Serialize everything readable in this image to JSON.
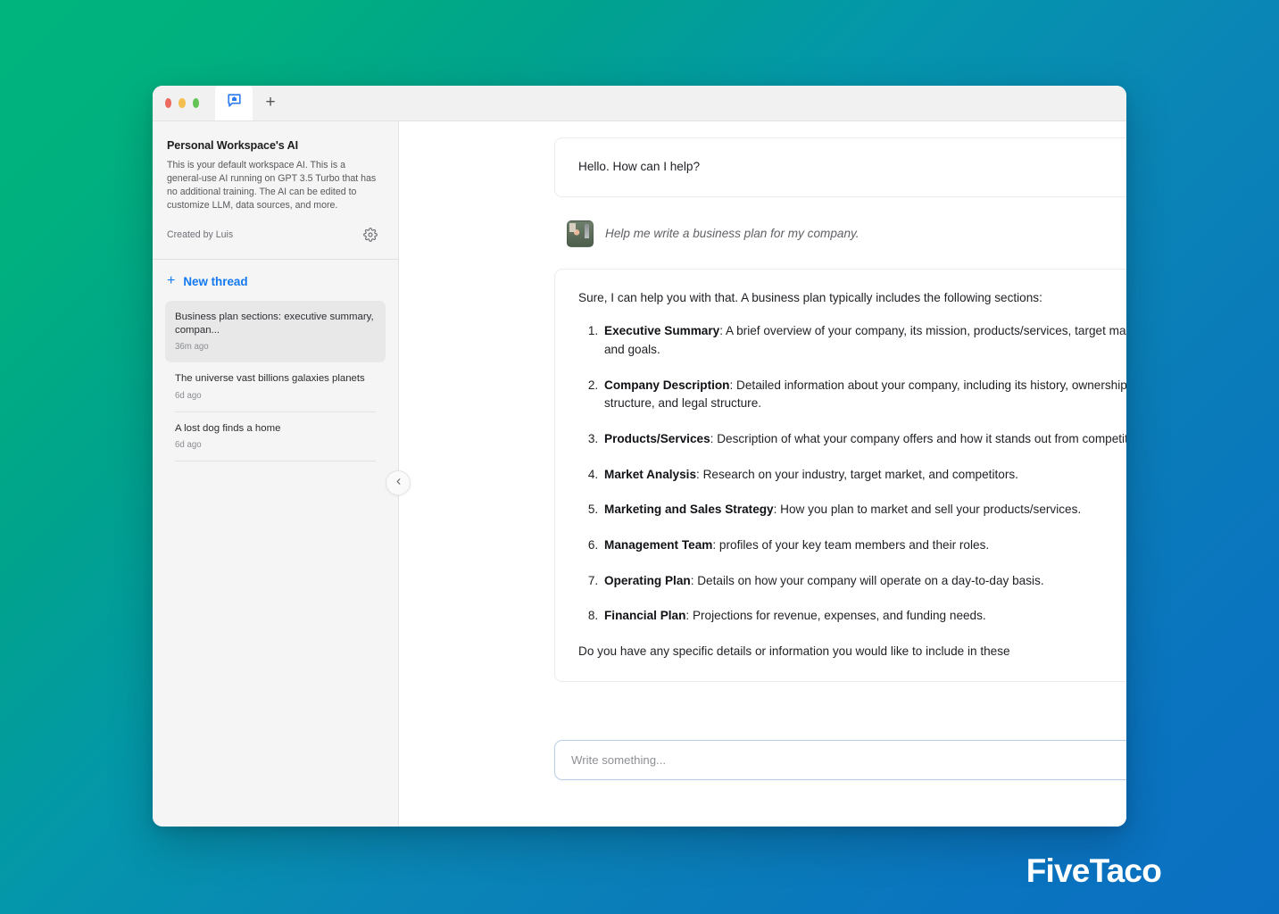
{
  "window": {
    "traffic_lights": [
      "close",
      "minimize",
      "maximize"
    ],
    "tab_icon": "chat-home-icon",
    "new_tab_label": "+"
  },
  "sidebar": {
    "workspace_title": "Personal Workspace's AI",
    "workspace_description": "This is your default workspace AI. This is a general-use AI running on GPT 3.5 Turbo that has no additional training. The AI can be edited to customize LLM, data sources, and more.",
    "created_by": "Created by Luis",
    "settings_icon": "gear-icon",
    "new_thread_label": "New thread",
    "new_thread_icon": "plus-icon",
    "collapse_icon": "chevron-left-icon",
    "threads": [
      {
        "title": "Business plan sections: executive summary, compan...",
        "time": "36m ago",
        "selected": true
      },
      {
        "title": "The universe vast billions galaxies planets",
        "time": "6d ago",
        "selected": false
      },
      {
        "title": "A lost dog finds a home",
        "time": "6d ago",
        "selected": false
      }
    ]
  },
  "chat": {
    "greeting": "Hello. How can I help?",
    "user_message": "Help me write a business plan for my company.",
    "user_avatar": "user-photo-avatar",
    "assistant_intro": "Sure, I can help you with that. A business plan typically includes the following sections:",
    "sections": [
      {
        "term": "Executive Summary",
        "desc": ": A brief overview of your company, its mission, products/services, target market, and goals."
      },
      {
        "term": "Company Description",
        "desc": ": Detailed information about your company, including its history, ownership structure, and legal structure."
      },
      {
        "term": "Products/Services",
        "desc": ": Description of what your company offers and how it stands out from competitors."
      },
      {
        "term": "Market Analysis",
        "desc": ": Research on your industry, target market, and competitors."
      },
      {
        "term": "Marketing and Sales Strategy",
        "desc": ": How you plan to market and sell your products/services."
      },
      {
        "term": "Management Team",
        "desc": ": profiles of your key team members and their roles."
      },
      {
        "term": "Operating Plan",
        "desc": ": Details on how your company will operate on a day-to-day basis."
      },
      {
        "term": "Financial Plan",
        "desc": ": Projections for revenue, expenses, and funding needs."
      }
    ],
    "closing": "Do you have any specific details or information you would like to include in these"
  },
  "composer": {
    "placeholder": "Write something...",
    "value": ""
  },
  "branding": {
    "name": "FiveTaco"
  },
  "colors": {
    "accent_blue": "#1379ee",
    "bg_gradient_start": "#00b57d",
    "bg_gradient_end": "#0b6fc1",
    "selected_thread_bg": "#e8e8e8",
    "composer_border": "#b9cfe9"
  }
}
